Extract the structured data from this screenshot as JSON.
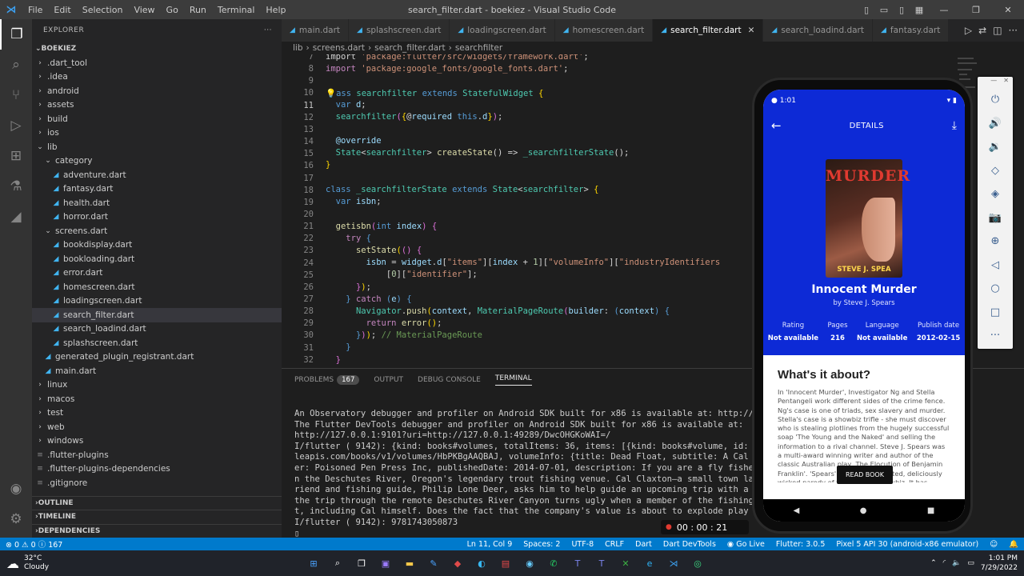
{
  "titlebar": {
    "title": "search_filter.dart - boekiez - Visual Studio Code",
    "menu": [
      "File",
      "Edit",
      "Selection",
      "View",
      "Go",
      "Run",
      "Terminal",
      "Help"
    ]
  },
  "sidebar": {
    "header": "EXPLORER",
    "root": "BOEKIEZ",
    "tree": [
      {
        "t": ".dart_tool",
        "d": 1,
        "type": "folder"
      },
      {
        "t": ".idea",
        "d": 1,
        "type": "folder"
      },
      {
        "t": "android",
        "d": 1,
        "type": "folder"
      },
      {
        "t": "assets",
        "d": 1,
        "type": "folder"
      },
      {
        "t": "build",
        "d": 1,
        "type": "folder"
      },
      {
        "t": "ios",
        "d": 1,
        "type": "folder"
      },
      {
        "t": "lib",
        "d": 1,
        "type": "open"
      },
      {
        "t": "category",
        "d": 2,
        "type": "open"
      },
      {
        "t": "adventure.dart",
        "d": 3,
        "type": "dart"
      },
      {
        "t": "fantasy.dart",
        "d": 3,
        "type": "dart"
      },
      {
        "t": "health.dart",
        "d": 3,
        "type": "dart"
      },
      {
        "t": "horror.dart",
        "d": 3,
        "type": "dart"
      },
      {
        "t": "screens.dart",
        "d": 2,
        "type": "open"
      },
      {
        "t": "bookdisplay.dart",
        "d": 3,
        "type": "dart"
      },
      {
        "t": "bookloading.dart",
        "d": 3,
        "type": "dart"
      },
      {
        "t": "error.dart",
        "d": 3,
        "type": "dart"
      },
      {
        "t": "homescreen.dart",
        "d": 3,
        "type": "dart"
      },
      {
        "t": "loadingscreen.dart",
        "d": 3,
        "type": "dart"
      },
      {
        "t": "search_filter.dart",
        "d": 3,
        "type": "dart",
        "sel": true
      },
      {
        "t": "search_loadind.dart",
        "d": 3,
        "type": "dart"
      },
      {
        "t": "splashscreen.dart",
        "d": 3,
        "type": "dart"
      },
      {
        "t": "generated_plugin_registrant.dart",
        "d": 2,
        "type": "dart"
      },
      {
        "t": "main.dart",
        "d": 2,
        "type": "dart"
      },
      {
        "t": "linux",
        "d": 1,
        "type": "folder"
      },
      {
        "t": "macos",
        "d": 1,
        "type": "folder"
      },
      {
        "t": "test",
        "d": 1,
        "type": "folder"
      },
      {
        "t": "web",
        "d": 1,
        "type": "folder"
      },
      {
        "t": "windows",
        "d": 1,
        "type": "folder"
      },
      {
        "t": ".flutter-plugins",
        "d": 1,
        "type": "file"
      },
      {
        "t": ".flutter-plugins-dependencies",
        "d": 1,
        "type": "file"
      },
      {
        "t": ".gitignore",
        "d": 1,
        "type": "file"
      }
    ],
    "sections": [
      "OUTLINE",
      "TIMELINE",
      "DEPENDENCIES"
    ]
  },
  "tabs": [
    {
      "label": "main.dart"
    },
    {
      "label": "splashscreen.dart"
    },
    {
      "label": "loadingscreen.dart"
    },
    {
      "label": "homescreen.dart"
    },
    {
      "label": "search_filter.dart",
      "active": true
    },
    {
      "label": "search_loadind.dart"
    },
    {
      "label": "fantasy.dart"
    }
  ],
  "breadcrumb": [
    "lib",
    "screens.dart",
    "search_filter.dart",
    "searchfilter"
  ],
  "editor": {
    "lines": [
      7,
      8,
      9,
      10,
      11,
      12,
      13,
      14,
      15,
      16,
      17,
      18,
      19,
      20,
      21,
      22,
      23,
      24,
      25,
      26,
      27,
      28,
      29,
      30,
      31,
      32
    ],
    "current": 11
  },
  "panel": {
    "tabs": [
      "PROBLEMS",
      "OUTPUT",
      "DEBUG CONSOLE",
      "TERMINAL"
    ],
    "problems_count": "167",
    "terminal": [
      "An Observatory debugger and profiler on Android SDK built for x86 is available at: http://127.0",
      "The Flutter DevTools debugger and profiler on Android SDK built for x86 is available at:",
      "http://127.0.0.1:9101?uri=http://127.0.0.1:49289/DwcOHGKoWAI=/",
      "I/flutter ( 9142): {kind: books#volumes, totalItems: 36, items: [{kind: books#volume, id: HbPKB                     .www.goog",
      "leapis.com/books/v1/volumes/HbPKBgAAQBAJ, volumeInfo: {title: Dead Float, subtitle: A Cal Claxt                     publish",
      "er: Poisoned Pen Press Inc, publishedDate: 2014-07-01, description: If you are a fly fisherman,                      hatch o",
      "n the Deschutes River, Oregon's legendary trout fishing venue. Cal Claxton—a small town lawyer                       best f",
      "riend and fishing guide, Philip Lone Deer, asks him to help guide an upcoming trip with a group                      But",
      "the trip through the remote Deschutes River Canyon turns ugly when a member of the fishing part                      suspec",
      "t, including Cal himself. Does the fact that the company's value is about to explode play into",
      "I/flutter ( 9142): 9781743050873"
    ]
  },
  "recording": "00 : 00 : 21",
  "statusbar": {
    "errors": "0",
    "warnings": "0",
    "info": "167",
    "pos": "Ln 11, Col 9",
    "spaces": "Spaces: 2",
    "enc": "UTF-8",
    "eol": "CRLF",
    "lang": "Dart",
    "devtools": "Dart DevTools",
    "golive": "Go Live",
    "flutter": "Flutter: 3.0.5",
    "device": "Pixel 5 API 30 (android-x86 emulator)"
  },
  "taskbar": {
    "temp": "32°C",
    "weather": "Cloudy",
    "time": "1:01 PM",
    "date": "7/29/2022"
  },
  "phone": {
    "time": "1:01",
    "appbar_title": "DETAILS",
    "cover_title": "MURDER",
    "cover_author": "STEVE J. SPEA",
    "book_title": "Innocent Murder",
    "book_author": "by Steve J. Spears",
    "meta": [
      {
        "label": "Rating",
        "value": "Not available"
      },
      {
        "label": "Pages",
        "value": "216"
      },
      {
        "label": "Language",
        "value": "Not available"
      },
      {
        "label": "Publish date",
        "value": "2012-02-15"
      }
    ],
    "about_heading": "What's it about?",
    "about_text": "In 'Innocent Murder', Investigator Ng and Stella Pentangeli work different sides of the crime fence. Ng's case is one of triads, sex slavery and murder. Stella's case is a showbiz trifle - she must discover who is stealing plotlines from the hugely successful soap 'The Young and the Naked' and selling the information to a rival channel. Steve J. Spears was a multi-award winning writer and author of the classic Australian play, The Elocution of Benjamin Franklin'. 'Spears' work is unexpected, deliciously wicked parody of the world of showbiz. It has",
    "read_button": "READ BOOK"
  }
}
